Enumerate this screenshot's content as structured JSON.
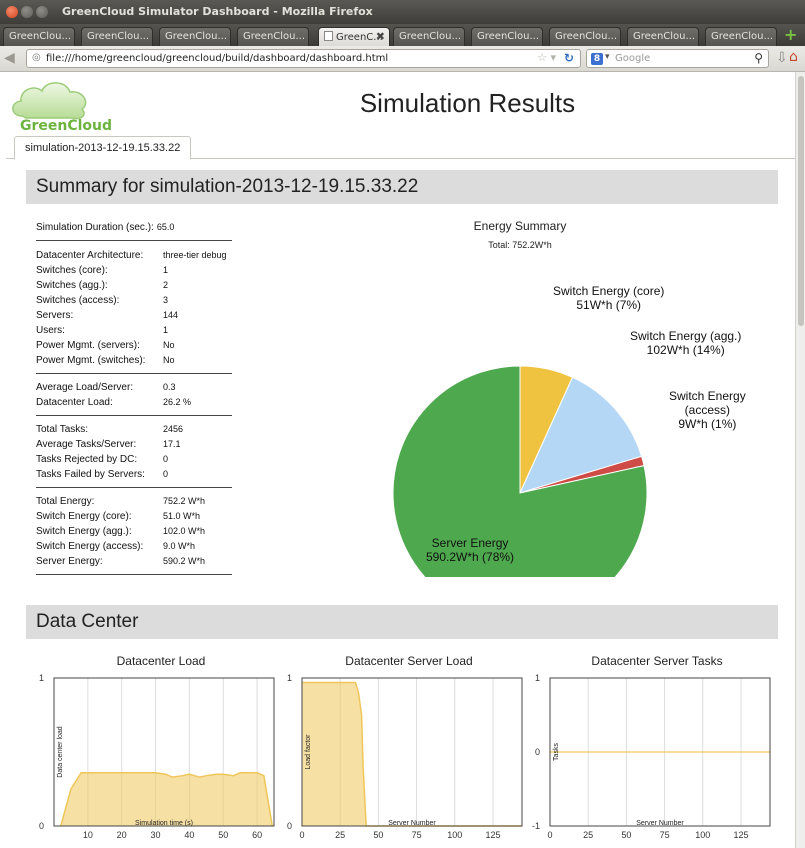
{
  "window": {
    "title": "GreenCloud Simulator Dashboard - Mozilla Firefox"
  },
  "browser": {
    "tabs": [
      {
        "label": "GreenClou..."
      },
      {
        "label": "GreenClou..."
      },
      {
        "label": "GreenClou..."
      },
      {
        "label": "GreenClou..."
      },
      {
        "label": "GreenC..."
      },
      {
        "label": "GreenClou..."
      },
      {
        "label": "GreenClou..."
      },
      {
        "label": "GreenClou..."
      },
      {
        "label": "GreenClou..."
      },
      {
        "label": "GreenClou..."
      }
    ],
    "active_tab_index": 4,
    "url": "file:///home/greencloud/greencloud/build/dashboard/dashboard.html",
    "search_engine_letter": "8",
    "search_placeholder": "Google"
  },
  "page": {
    "logo_text": "GreenCloud",
    "title": "Simulation Results",
    "tab_label": "simulation-2013-12-19.15.33.22",
    "summary_heading": "Summary for simulation-2013-12-19.15.33.22",
    "datacenter_heading": "Data Center"
  },
  "stats": {
    "duration": {
      "label": "Simulation Duration (sec.):",
      "value": "65.0"
    },
    "groups": [
      [
        {
          "label": "Datacenter Architecture:",
          "value": "three-tier debug"
        },
        {
          "label": "Switches (core):",
          "value": "1"
        },
        {
          "label": "Switches (agg.):",
          "value": "2"
        },
        {
          "label": "Switches (access):",
          "value": "3"
        },
        {
          "label": "Servers:",
          "value": "144"
        },
        {
          "label": "Users:",
          "value": "1"
        },
        {
          "label": "Power Mgmt. (servers):",
          "value": "No"
        },
        {
          "label": "Power Mgmt. (switches):",
          "value": "No"
        }
      ],
      [
        {
          "label": "Average Load/Server:",
          "value": "0.3"
        },
        {
          "label": "Datacenter Load:",
          "value": "26.2 %"
        }
      ],
      [
        {
          "label": "Total Tasks:",
          "value": "2456"
        },
        {
          "label": "Average Tasks/Server:",
          "value": "17.1"
        },
        {
          "label": "Tasks Rejected by DC:",
          "value": "0"
        },
        {
          "label": "Tasks Failed by Servers:",
          "value": "0"
        }
      ],
      [
        {
          "label": "Total Energy:",
          "value": "752.2 W*h"
        },
        {
          "label": "Switch Energy (core):",
          "value": "51.0 W*h"
        },
        {
          "label": "Switch Energy (agg.):",
          "value": "102.0 W*h"
        },
        {
          "label": "Switch Energy (access):",
          "value": "9.0 W*h"
        },
        {
          "label": "Server Energy:",
          "value": "590.2 W*h"
        }
      ]
    ]
  },
  "chart_data": [
    {
      "type": "pie",
      "title": "Energy Summary",
      "subtitle": "Total: 752.2W*h",
      "slices": [
        {
          "label": "Switch Energy (core)",
          "value": 51,
          "value_label": "51W*h (7%)",
          "color": "#efc23f"
        },
        {
          "label": "Switch Energy (agg.)",
          "value": 102,
          "value_label": "102W*h (14%)",
          "color": "#b3d7f5"
        },
        {
          "label": "Switch Energy (access)",
          "value": 9,
          "value_label": "9W*h (1%)",
          "color": "#cf4b45"
        },
        {
          "label": "Server Energy",
          "value": 590.2,
          "value_label": "590.2W*h (78%)",
          "color": "#4ea84d"
        }
      ]
    },
    {
      "type": "area",
      "title": "Datacenter Load",
      "xlabel": "Simulation time (s)",
      "ylabel": "Data center load",
      "xlim": [
        0,
        65
      ],
      "ylim": [
        0,
        1
      ],
      "xticks": [
        10,
        20,
        30,
        40,
        50,
        60
      ],
      "yticks": [
        0,
        1
      ],
      "grid": "vertical",
      "color": "#efc65a",
      "x": [
        2,
        5,
        8,
        10,
        15,
        20,
        25,
        30,
        33,
        35,
        38,
        40,
        43,
        45,
        48,
        50,
        53,
        55,
        58,
        60,
        62,
        64.5
      ],
      "y": [
        0,
        0.25,
        0.36,
        0.36,
        0.36,
        0.36,
        0.36,
        0.36,
        0.35,
        0.33,
        0.34,
        0.35,
        0.33,
        0.34,
        0.35,
        0.35,
        0.34,
        0.36,
        0.36,
        0.36,
        0.34,
        0
      ]
    },
    {
      "type": "area",
      "title": "Datacenter Server Load",
      "xlabel": "Server Number",
      "ylabel": "Load factor",
      "xlim": [
        0,
        144
      ],
      "ylim": [
        0,
        1
      ],
      "xticks": [
        0,
        25,
        50,
        75,
        100,
        125
      ],
      "yticks": [
        0,
        1
      ],
      "grid": "vertical",
      "color": "#efc65a",
      "x": [
        0,
        35,
        37,
        39,
        40,
        42,
        144
      ],
      "y": [
        0.97,
        0.97,
        0.9,
        0.75,
        0.4,
        0,
        0
      ]
    },
    {
      "type": "line",
      "title": "Datacenter Server Tasks",
      "xlabel": "Server Number",
      "ylabel": "Tasks",
      "xlim": [
        0,
        144
      ],
      "ylim": [
        -1,
        1
      ],
      "xticks": [
        0,
        25,
        50,
        75,
        100,
        125
      ],
      "yticks": [
        -1,
        0,
        1
      ],
      "grid": "vertical",
      "color": "#efc65a",
      "x": [
        0,
        144
      ],
      "y": [
        0,
        0
      ]
    }
  ]
}
